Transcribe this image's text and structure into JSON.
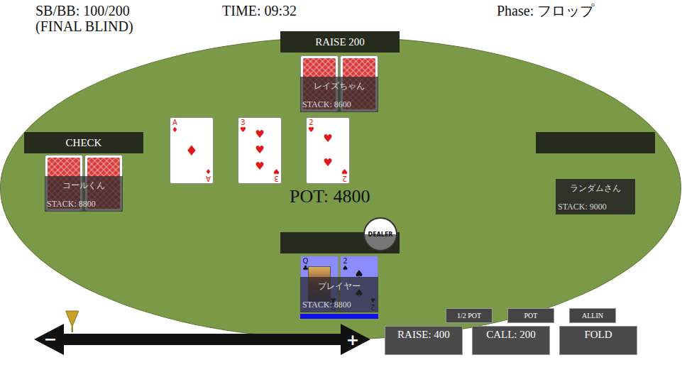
{
  "header": {
    "blinds": "SB/BB: 100/200",
    "blind_level": "(FINAL BLIND)",
    "time": "TIME: 09:32",
    "phase": "Phase: フロップ"
  },
  "seats": [
    {
      "action": "RAISE 200",
      "name": "レイズちゃん",
      "stack": "STACK: 8600",
      "active": false,
      "cards": [
        {
          "face_up": false
        },
        {
          "face_up": false
        }
      ]
    },
    {
      "action": "CHECK",
      "name": "コールくん",
      "stack": "STACK: 8800",
      "active": false,
      "cards": [
        {
          "face_up": false
        },
        {
          "face_up": false
        }
      ]
    },
    {
      "action": "",
      "name": "ランダムさん",
      "stack": "STACK: 9000",
      "active": false,
      "cards": []
    },
    {
      "action": "",
      "name": "プレイヤー",
      "stack": "STACK: 8800",
      "active": true,
      "cards": [
        {
          "face_up": true,
          "rank": "Q",
          "suit": "♣",
          "color": "#111111"
        },
        {
          "face_up": true,
          "rank": "2",
          "suit": "♠",
          "color": "#111111"
        }
      ]
    }
  ],
  "board": [
    {
      "rank": "A",
      "suit": "♦",
      "color": "#e01818"
    },
    {
      "rank": "3",
      "suit": "♥",
      "color": "#e01818"
    },
    {
      "rank": "2",
      "suit": "♥",
      "color": "#e01818"
    }
  ],
  "pot": "POT: 4800",
  "dealer_button": "DEALER",
  "bet_slider": {
    "level": 0.03,
    "minus": "−",
    "plus": "+"
  },
  "presets": [
    "1/2 POT",
    "POT",
    "ALLIN"
  ],
  "actions": [
    "RAISE: 400",
    "CALL: 200",
    "FOLD"
  ]
}
